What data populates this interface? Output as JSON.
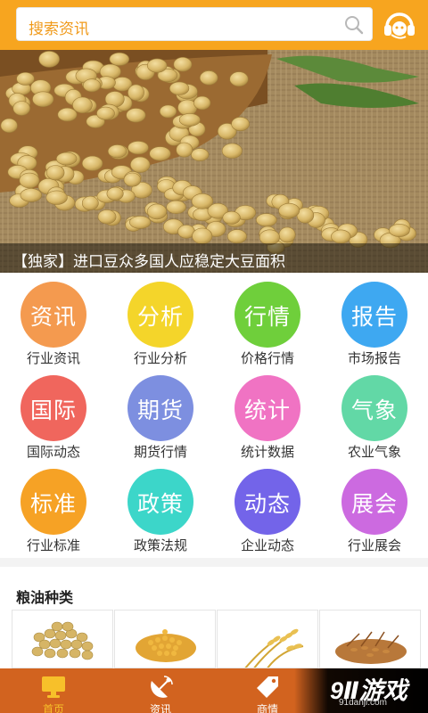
{
  "header": {
    "search_placeholder": "搜索资讯",
    "search_icon": "search-icon",
    "service_icon": "headset-icon",
    "accent": "#f7a51f"
  },
  "banner": {
    "caption": "【独家】进口豆众多国人应稳定大豆面积"
  },
  "grid": [
    {
      "icon_text": "资讯",
      "label": "行业资讯",
      "color": "#f49a4f"
    },
    {
      "icon_text": "分析",
      "label": "行业分析",
      "color": "#f4d52a"
    },
    {
      "icon_text": "行情",
      "label": "价格行情",
      "color": "#6fcf3b"
    },
    {
      "icon_text": "报告",
      "label": "市场报告",
      "color": "#3ea8f1"
    },
    {
      "icon_text": "国际",
      "label": "国际动态",
      "color": "#f0665d"
    },
    {
      "icon_text": "期货",
      "label": "期货行情",
      "color": "#7d8fe0"
    },
    {
      "icon_text": "统计",
      "label": "统计数据",
      "color": "#f073c3"
    },
    {
      "icon_text": "气象",
      "label": "农业气象",
      "color": "#62d8a6"
    },
    {
      "icon_text": "标准",
      "label": "行业标准",
      "color": "#f6a225"
    },
    {
      "icon_text": "政策",
      "label": "政策法规",
      "color": "#3cd6c9"
    },
    {
      "icon_text": "动态",
      "label": "企业动态",
      "color": "#7364e9"
    },
    {
      "icon_text": "展会",
      "label": "行业展会",
      "color": "#cc6ae0"
    }
  ],
  "section": {
    "title": "粮油种类",
    "items": [
      "soybean",
      "corn",
      "wheat",
      "rice"
    ]
  },
  "bottom_nav": {
    "items": [
      {
        "label": "首页",
        "icon": "monitor-icon",
        "active": true
      },
      {
        "label": "资讯",
        "icon": "satellite-dish-icon",
        "active": false
      },
      {
        "label": "商情",
        "icon": "tag-icon",
        "active": false
      }
    ]
  },
  "watermark": {
    "main": "9Ⅱ游戏",
    "sub": "91danji.com"
  }
}
